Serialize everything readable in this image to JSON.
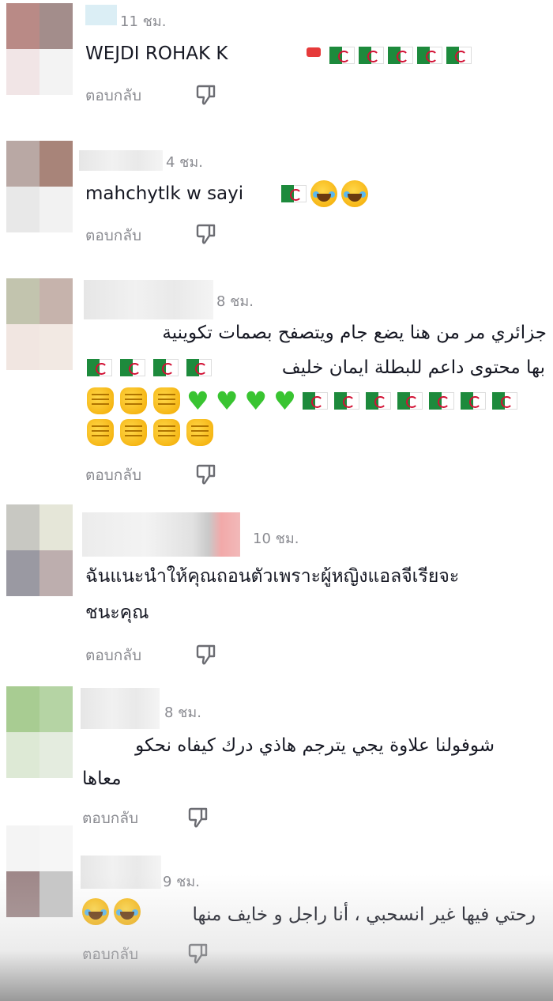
{
  "reply_label": "ตอบกลับ",
  "comments": [
    {
      "time": "11 ชม.",
      "text": "WEJDI ROHAK K"
    },
    {
      "time": "4 ชม.",
      "text": "mahchytlk w sayi"
    },
    {
      "time": "8 ชม.",
      "line1": "جزائري مر من هنا يضع جام ويتصفح بصمات تكوينية",
      "line2": "بها محتوى داعم للبطلة ايمان خليف"
    },
    {
      "time": "10 ชม.",
      "line1": "ฉันแนะนำให้คุณถอนตัวเพราะผู้หญิงแอลจีเรียจะ",
      "line2": "ชนะคุณ"
    },
    {
      "time": "8 ชม.",
      "line1": "شوفولنا علاوة يجي يترجم هاذي درك كيفاه نحكو",
      "line2": "معاها"
    },
    {
      "time": "9 ชม.",
      "text": "رحتي فيها غير انسحبي ، أنا راجل و خايف منها"
    }
  ],
  "icons": {
    "dislike": "thumb-down-icon",
    "flag": "algeria-flag-icon",
    "fist": "raised-fist-icon",
    "heart": "green-heart-icon",
    "laugh": "tears-of-joy-icon"
  },
  "colors": {
    "text": "#161823",
    "muted": "#8a8b91",
    "flag_green": "#1d8a3c",
    "flag_red": "#d21034",
    "heart_green": "#39c431"
  }
}
